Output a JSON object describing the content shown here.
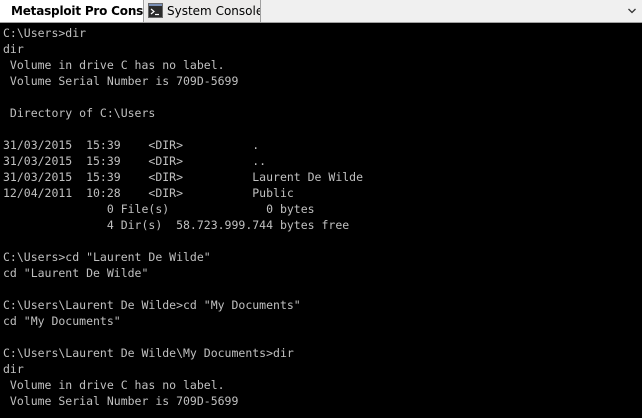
{
  "tabs": [
    {
      "label": "Metasploit Pro Conso..."
    },
    {
      "label": "System Console"
    }
  ],
  "console": {
    "lines": [
      "C:\\Users>dir",
      "dir",
      " Volume in drive C has no label.",
      " Volume Serial Number is 709D-5699",
      "",
      " Directory of C:\\Users",
      "",
      "31/03/2015  15:39    <DIR>          .",
      "31/03/2015  15:39    <DIR>          ..",
      "31/03/2015  15:39    <DIR>          Laurent De Wilde",
      "12/04/2011  10:28    <DIR>          Public",
      "               0 File(s)              0 bytes",
      "               4 Dir(s)  58.723.999.744 bytes free",
      "",
      "C:\\Users>cd \"Laurent De Wilde\"",
      "cd \"Laurent De Wilde\"",
      "",
      "C:\\Users\\Laurent De Wilde>cd \"My Documents\"",
      "cd \"My Documents\"",
      "",
      "C:\\Users\\Laurent De Wilde\\My Documents>dir",
      "dir",
      " Volume in drive C has no label.",
      " Volume Serial Number is 709D-5699"
    ]
  },
  "icons": {
    "system_console_tab": "console-window-icon",
    "tab_menu": "chevron-down-icon"
  },
  "colors": {
    "console_background": "#000000",
    "console_text": "#c0c0c0",
    "tabbar_background": "#f0f0f0"
  }
}
